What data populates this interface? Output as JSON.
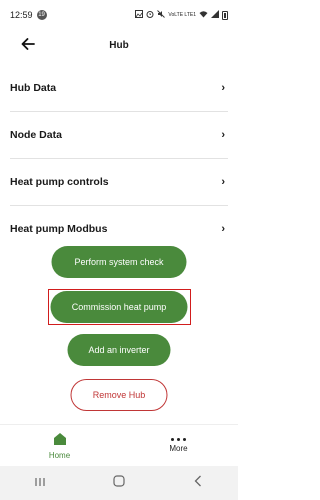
{
  "status_bar": {
    "time": "12:59",
    "badge": "19",
    "network": "VoLTE LTE1",
    "icons": [
      "photo-icon",
      "alarm-icon",
      "mute-icon",
      "wifi-icon",
      "signal-icon",
      "battery-icon"
    ]
  },
  "header": {
    "title": "Hub",
    "back_icon": "arrow-left-icon"
  },
  "menu": {
    "items": [
      {
        "label": "Hub Data",
        "chevron": "›"
      },
      {
        "label": "Node Data",
        "chevron": "›"
      },
      {
        "label": "Heat pump controls",
        "chevron": "›"
      },
      {
        "label": "Heat pump Modbus",
        "chevron": "›"
      }
    ]
  },
  "actions": {
    "perform_check": "Perform system check",
    "commission": "Commission heat pump",
    "add_inverter": "Add an inverter",
    "remove_hub": "Remove Hub"
  },
  "bottom_nav": {
    "home_label": "Home",
    "more_label": "More"
  },
  "colors": {
    "accent_green": "#4a8a3c",
    "danger_red": "#c03636",
    "highlight_red": "#d11d1d"
  }
}
